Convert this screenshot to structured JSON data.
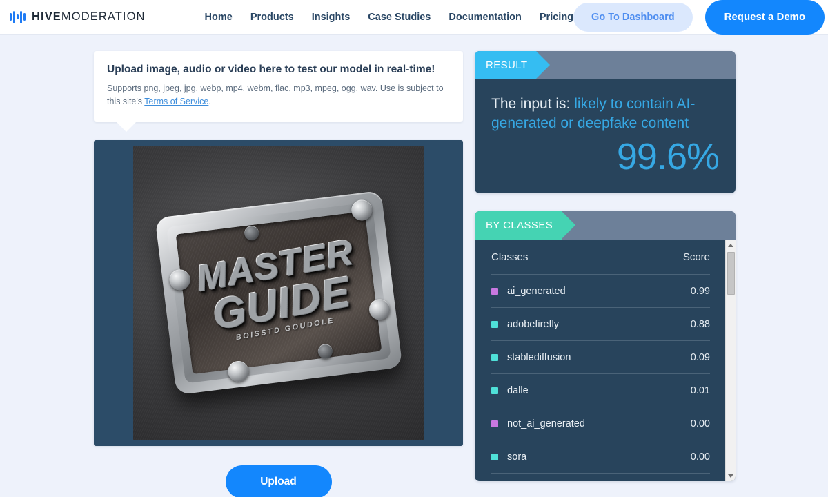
{
  "header": {
    "brand": {
      "strong": "HIVE",
      "light": "MODERATION",
      "logo_icon": "waveform-bars-icon"
    },
    "nav": [
      {
        "label": "Home"
      },
      {
        "label": "Products"
      },
      {
        "label": "Insights"
      },
      {
        "label": "Case Studies"
      },
      {
        "label": "Documentation"
      },
      {
        "label": "Pricing"
      }
    ],
    "dashboard_button": "Go To Dashboard",
    "demo_button": "Request a Demo"
  },
  "upload": {
    "title": "Upload image, audio or video here to test our model in real-time!",
    "supports_prefix": "Supports png, jpeg, jpg, webp, mp4, webm, flac, mp3, mpeg, ogg, wav. Use is subject to this site's ",
    "terms_link": "Terms of Service",
    "supports_suffix": ".",
    "button": "Upload"
  },
  "preview": {
    "alt": "metallic plaque image",
    "plaque_line1": "MASTER",
    "plaque_line2": "GUIDE",
    "plaque_sub": "BOISSTD GOUDOLE"
  },
  "result": {
    "tab": "RESULT",
    "lead": "The input is:",
    "verdict": "likely to contain AI-generated or deepfake content",
    "score": "99.6%"
  },
  "classes": {
    "tab": "BY CLASSES",
    "col_classes": "Classes",
    "col_score": "Score",
    "rows": [
      {
        "name": "ai_generated",
        "score": "0.99",
        "color": "#c878e0"
      },
      {
        "name": "adobefirefly",
        "score": "0.88",
        "color": "#4fe0d8"
      },
      {
        "name": "stablediffusion",
        "score": "0.09",
        "color": "#4fe0d8"
      },
      {
        "name": "dalle",
        "score": "0.01",
        "color": "#4fe0d8"
      },
      {
        "name": "not_ai_generated",
        "score": "0.00",
        "color": "#c878e0"
      },
      {
        "name": "sora",
        "score": "0.00",
        "color": "#4fe0d8"
      }
    ]
  },
  "colors": {
    "accent_blue": "#1387fd",
    "result_tab": "#35bdf2",
    "classes_tab": "#45d3b3",
    "panel_bg": "#28445c",
    "panel_head": "#6d8099",
    "verdict_text": "#36a8e4",
    "page_bg": "#eef2fb"
  }
}
